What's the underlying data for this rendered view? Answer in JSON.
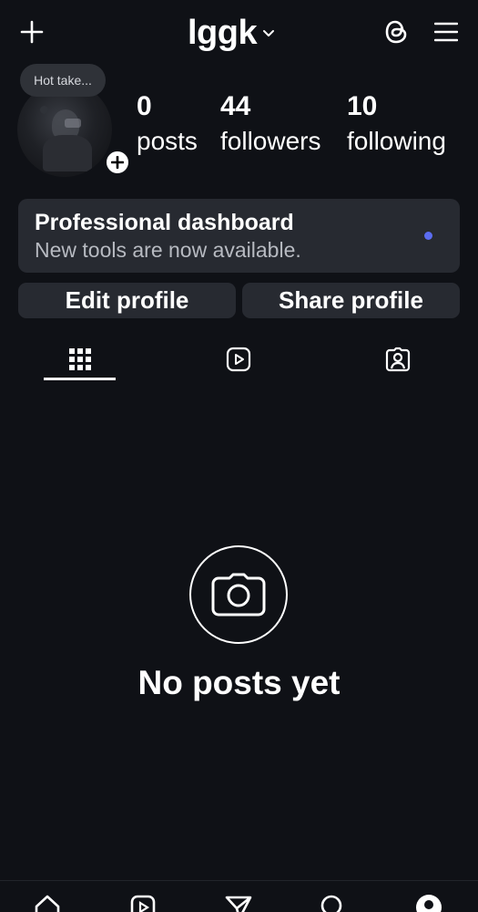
{
  "header": {
    "username": "lggk"
  },
  "profile": {
    "note": "Hot take...",
    "stats": {
      "posts": {
        "value": "0",
        "label": "posts"
      },
      "followers": {
        "value": "44",
        "label": "followers"
      },
      "following": {
        "value": "10",
        "label": "following"
      }
    }
  },
  "dashboard": {
    "title": "Professional dashboard",
    "subtitle": "New tools are now available.",
    "dot_color": "#5b6cf0"
  },
  "buttons": {
    "edit": "Edit profile",
    "share": "Share profile"
  },
  "tabs": [
    {
      "icon": "grid-icon",
      "active": true
    },
    {
      "icon": "reels-icon",
      "active": false
    },
    {
      "icon": "tagged-icon",
      "active": false
    }
  ],
  "empty_state": {
    "icon": "camera-icon",
    "text": "No posts yet"
  },
  "bottom_nav": [
    {
      "icon": "home-icon"
    },
    {
      "icon": "reels-icon"
    },
    {
      "icon": "send-icon"
    },
    {
      "icon": "search-icon"
    },
    {
      "icon": "profile-icon",
      "active": true
    }
  ]
}
